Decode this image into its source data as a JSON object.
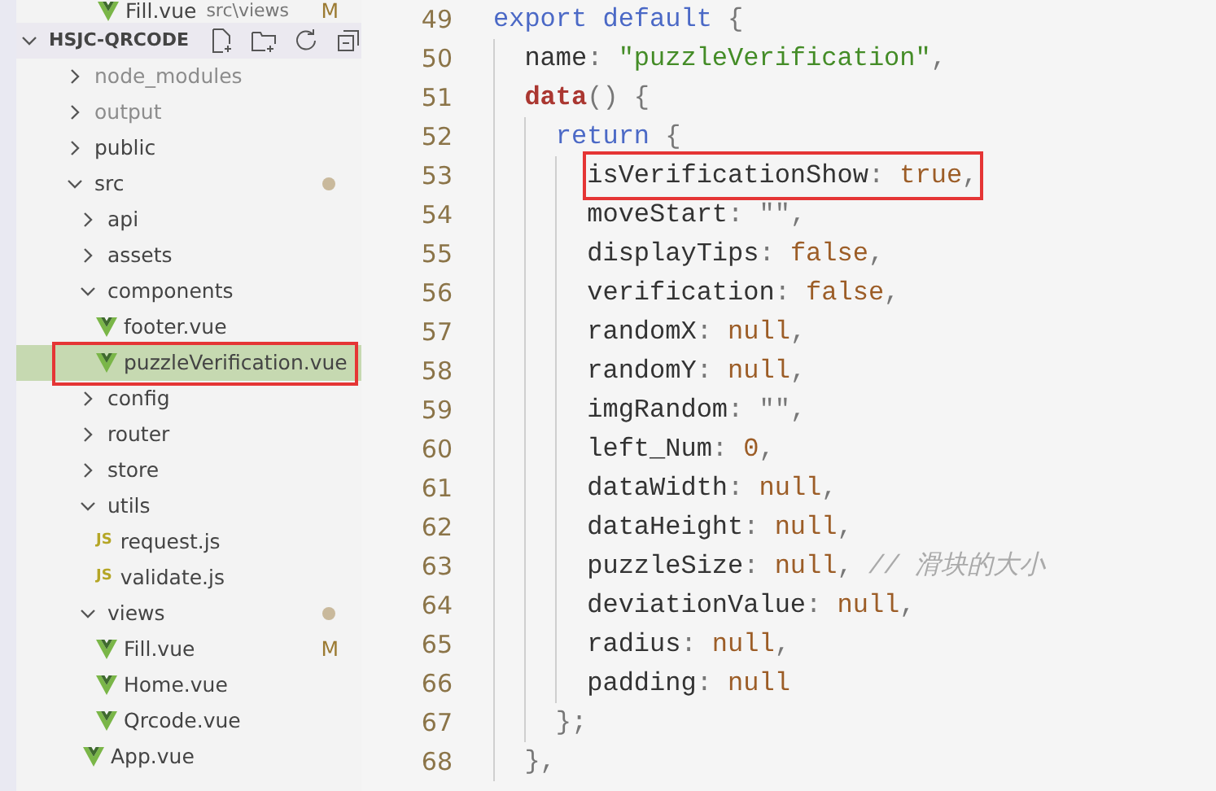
{
  "open_editor": {
    "name": "Fill.vue",
    "path": "src\\views",
    "status": "M"
  },
  "explorer": {
    "title": "HSJC-QRCODE",
    "expanded": true,
    "tree": [
      {
        "kind": "folder",
        "name": "node_modules",
        "expanded": false,
        "dimmed": true
      },
      {
        "kind": "folder",
        "name": "output",
        "expanded": false,
        "dimmed": true
      },
      {
        "kind": "folder",
        "name": "public",
        "expanded": false
      },
      {
        "kind": "folder",
        "name": "src",
        "expanded": true,
        "modified_dot": true,
        "children": [
          {
            "kind": "folder",
            "name": "api",
            "expanded": false
          },
          {
            "kind": "folder",
            "name": "assets",
            "expanded": false
          },
          {
            "kind": "folder",
            "name": "components",
            "expanded": true,
            "children": [
              {
                "kind": "vue",
                "name": "footer.vue",
                "selected": false,
                "highlighted": false
              },
              {
                "kind": "vue",
                "name": "puzzleVerification.vue",
                "selected": true,
                "highlighted": true
              }
            ]
          },
          {
            "kind": "folder",
            "name": "config",
            "expanded": false
          },
          {
            "kind": "folder",
            "name": "router",
            "expanded": false
          },
          {
            "kind": "folder",
            "name": "store",
            "expanded": false
          },
          {
            "kind": "folder",
            "name": "utils",
            "expanded": true,
            "children": [
              {
                "kind": "js",
                "icon": "JS",
                "name": "request.js"
              },
              {
                "kind": "js",
                "icon": "JS",
                "name": "validate.js"
              }
            ]
          },
          {
            "kind": "folder",
            "name": "views",
            "expanded": true,
            "modified_dot": true,
            "children": [
              {
                "kind": "vue",
                "name": "Fill.vue",
                "status": "M"
              },
              {
                "kind": "vue",
                "name": "Home.vue"
              },
              {
                "kind": "vue",
                "name": "Qrcode.vue"
              }
            ]
          },
          {
            "kind": "vue",
            "name": "App.vue"
          }
        ]
      }
    ]
  },
  "editor": {
    "lines": [
      {
        "number": "49",
        "tokens": [
          {
            "kind": "keyword",
            "text": "export default "
          },
          {
            "kind": "punct",
            "text": "{"
          }
        ],
        "children": [
          {
            "number": "50",
            "tokens": [
              {
                "kind": "plain",
                "text": "name"
              },
              {
                "kind": "punct",
                "text": ": "
              },
              {
                "kind": "string",
                "text": "\"puzzleVerification\""
              },
              {
                "kind": "punct",
                "text": ","
              }
            ]
          },
          {
            "number": "51",
            "tokens": [
              {
                "kind": "function",
                "text": "data"
              },
              {
                "kind": "punct",
                "text": "() {"
              }
            ],
            "children": [
              {
                "number": "52",
                "tokens": [
                  {
                    "kind": "keyword",
                    "text": "return "
                  },
                  {
                    "kind": "punct",
                    "text": "{"
                  }
                ],
                "children": [
                  {
                    "number": "53",
                    "highlighted": true,
                    "tokens": [
                      {
                        "kind": "plain",
                        "text": "isVerificationShow"
                      },
                      {
                        "kind": "punct",
                        "text": ": "
                      },
                      {
                        "kind": "literal",
                        "text": "true"
                      },
                      {
                        "kind": "punct",
                        "text": ","
                      }
                    ]
                  },
                  {
                    "number": "54",
                    "tokens": [
                      {
                        "kind": "plain",
                        "text": "moveStart"
                      },
                      {
                        "kind": "punct",
                        "text": ": \"\","
                      }
                    ]
                  },
                  {
                    "number": "55",
                    "tokens": [
                      {
                        "kind": "plain",
                        "text": "displayTips"
                      },
                      {
                        "kind": "punct",
                        "text": ": "
                      },
                      {
                        "kind": "literal",
                        "text": "false"
                      },
                      {
                        "kind": "punct",
                        "text": ","
                      }
                    ]
                  },
                  {
                    "number": "56",
                    "tokens": [
                      {
                        "kind": "plain",
                        "text": "verification"
                      },
                      {
                        "kind": "punct",
                        "text": ": "
                      },
                      {
                        "kind": "literal",
                        "text": "false"
                      },
                      {
                        "kind": "punct",
                        "text": ","
                      }
                    ]
                  },
                  {
                    "number": "57",
                    "tokens": [
                      {
                        "kind": "plain",
                        "text": "randomX"
                      },
                      {
                        "kind": "punct",
                        "text": ": "
                      },
                      {
                        "kind": "literal",
                        "text": "null"
                      },
                      {
                        "kind": "punct",
                        "text": ","
                      }
                    ]
                  },
                  {
                    "number": "58",
                    "tokens": [
                      {
                        "kind": "plain",
                        "text": "randomY"
                      },
                      {
                        "kind": "punct",
                        "text": ": "
                      },
                      {
                        "kind": "literal",
                        "text": "null"
                      },
                      {
                        "kind": "punct",
                        "text": ","
                      }
                    ]
                  },
                  {
                    "number": "59",
                    "tokens": [
                      {
                        "kind": "plain",
                        "text": "imgRandom"
                      },
                      {
                        "kind": "punct",
                        "text": ": \"\","
                      }
                    ]
                  },
                  {
                    "number": "60",
                    "tokens": [
                      {
                        "kind": "plain",
                        "text": "left_Num"
                      },
                      {
                        "kind": "punct",
                        "text": ": "
                      },
                      {
                        "kind": "literal",
                        "text": "0"
                      },
                      {
                        "kind": "punct",
                        "text": ","
                      }
                    ]
                  },
                  {
                    "number": "61",
                    "tokens": [
                      {
                        "kind": "plain",
                        "text": "dataWidth"
                      },
                      {
                        "kind": "punct",
                        "text": ": "
                      },
                      {
                        "kind": "literal",
                        "text": "null"
                      },
                      {
                        "kind": "punct",
                        "text": ","
                      }
                    ]
                  },
                  {
                    "number": "62",
                    "tokens": [
                      {
                        "kind": "plain",
                        "text": "dataHeight"
                      },
                      {
                        "kind": "punct",
                        "text": ": "
                      },
                      {
                        "kind": "literal",
                        "text": "null"
                      },
                      {
                        "kind": "punct",
                        "text": ","
                      }
                    ]
                  },
                  {
                    "number": "63",
                    "tokens": [
                      {
                        "kind": "plain",
                        "text": "puzzleSize"
                      },
                      {
                        "kind": "punct",
                        "text": ": "
                      },
                      {
                        "kind": "literal",
                        "text": "null"
                      },
                      {
                        "kind": "punct",
                        "text": ", "
                      },
                      {
                        "kind": "comment",
                        "text": "// 滑块的大小"
                      }
                    ]
                  },
                  {
                    "number": "64",
                    "tokens": [
                      {
                        "kind": "plain",
                        "text": "deviationValue"
                      },
                      {
                        "kind": "punct",
                        "text": ": "
                      },
                      {
                        "kind": "literal",
                        "text": "null"
                      },
                      {
                        "kind": "punct",
                        "text": ","
                      }
                    ]
                  },
                  {
                    "number": "65",
                    "tokens": [
                      {
                        "kind": "plain",
                        "text": "radius"
                      },
                      {
                        "kind": "punct",
                        "text": ": "
                      },
                      {
                        "kind": "literal",
                        "text": "null"
                      },
                      {
                        "kind": "punct",
                        "text": ","
                      }
                    ]
                  },
                  {
                    "number": "66",
                    "tokens": [
                      {
                        "kind": "plain",
                        "text": "padding"
                      },
                      {
                        "kind": "punct",
                        "text": ": "
                      },
                      {
                        "kind": "literal",
                        "text": "null"
                      }
                    ]
                  }
                ]
              },
              {
                "number": "67",
                "tokens": [
                  {
                    "kind": "punct",
                    "text": "};"
                  }
                ]
              }
            ]
          },
          {
            "number": "68",
            "tokens": [
              {
                "kind": "punct",
                "text": "},"
              }
            ]
          }
        ]
      }
    ]
  }
}
